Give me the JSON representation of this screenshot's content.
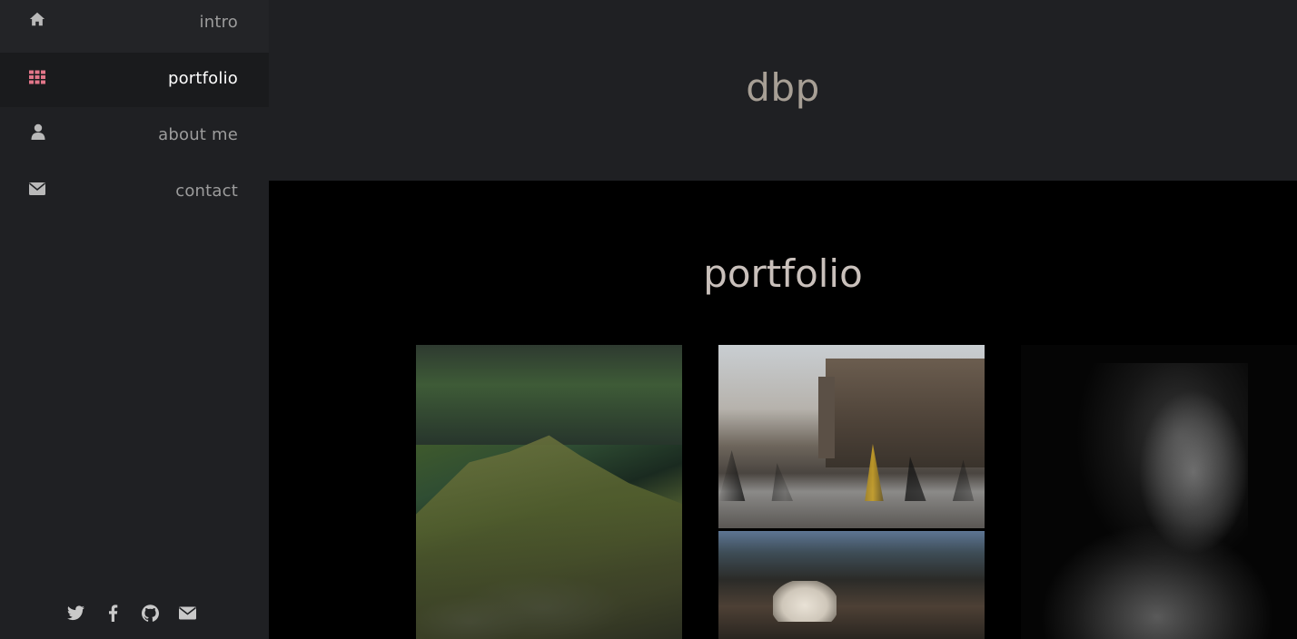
{
  "sidebar": {
    "items": [
      {
        "label": "intro",
        "icon": "home-icon"
      },
      {
        "label": "portfolio",
        "icon": "grid-icon",
        "active": true
      },
      {
        "label": "about me",
        "icon": "user-icon"
      },
      {
        "label": "contact",
        "icon": "envelope-icon"
      }
    ],
    "social": [
      "twitter-icon",
      "facebook-icon",
      "github-icon",
      "envelope-icon"
    ],
    "accent_color": "#e27689"
  },
  "header": {
    "title": "dbp"
  },
  "main": {
    "section_title": "portfolio",
    "photos": [
      "mountain",
      "city-square",
      "market",
      "portrait"
    ]
  }
}
